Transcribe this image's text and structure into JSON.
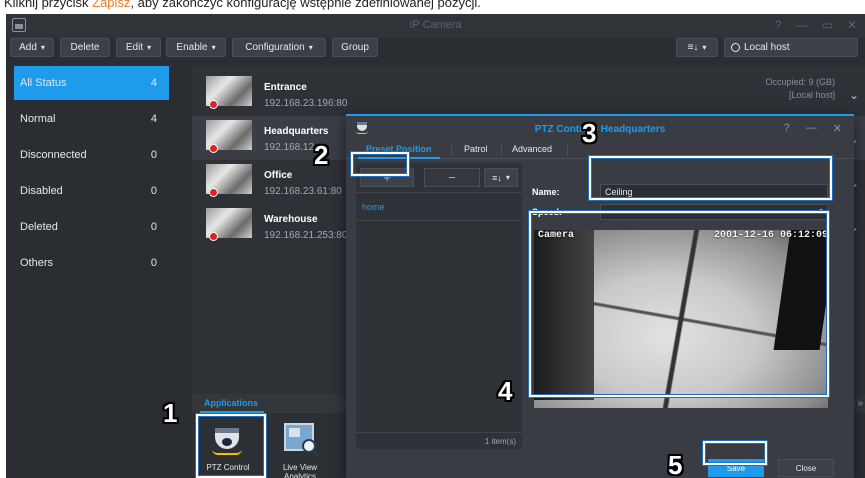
{
  "instruction": {
    "before": "Kliknij przycisk ",
    "highlight": "Zapisz",
    "after": ", aby zakończyć konfigurację wstępnie zdefiniowanej pozycji."
  },
  "window": {
    "title": "IP Camera",
    "controls": [
      "?",
      "—",
      "▭",
      "✕"
    ]
  },
  "toolbar": {
    "add": "Add",
    "delete": "Delete",
    "edit": "Edit",
    "enable": "Enable",
    "configuration": "Configuration",
    "group": "Group",
    "sort": "≡↓",
    "host_filter": "Local host"
  },
  "sidebar": {
    "items": [
      {
        "label": "All Status",
        "count": "4"
      },
      {
        "label": "Normal",
        "count": "4"
      },
      {
        "label": "Disconnected",
        "count": "0"
      },
      {
        "label": "Disabled",
        "count": "0"
      },
      {
        "label": "Deleted",
        "count": "0"
      },
      {
        "label": "Others",
        "count": "0"
      }
    ]
  },
  "cameras": [
    {
      "name": "Entrance",
      "ip": "192.168.23.196:80"
    },
    {
      "name": "Headquarters",
      "ip": "192.168.12."
    },
    {
      "name": "Office",
      "ip": "192.168.23.61:80"
    },
    {
      "name": "Warehouse",
      "ip": "192.168.21.253:80"
    }
  ],
  "occupied": {
    "text": "Occupied: 9 (GB)",
    "host": "[Local host]"
  },
  "applications": {
    "tab": "Applications",
    "items": [
      {
        "label": "PTZ Control"
      },
      {
        "label": "Live View Analytics"
      }
    ]
  },
  "dialog": {
    "title": "PTZ Control - Headquarters",
    "controls": [
      "?",
      "—",
      "✕"
    ],
    "tabs": [
      "Preset Position",
      "Patrol",
      "Advanced"
    ],
    "add_label": "+",
    "remove_label": "−",
    "sort_label": "≡↓",
    "presets": [
      "home"
    ],
    "footer": "1 item(s)",
    "name_label": "Name:",
    "name_value": "Ceiling",
    "speed_label": "Speed:",
    "speed_value": "-",
    "preview_osd_left": "Camera",
    "preview_osd_right": "2001-12-16 06:12:09",
    "save": "Save",
    "close": "Close"
  },
  "markers": [
    "1",
    "2",
    "3",
    "4",
    "5"
  ]
}
